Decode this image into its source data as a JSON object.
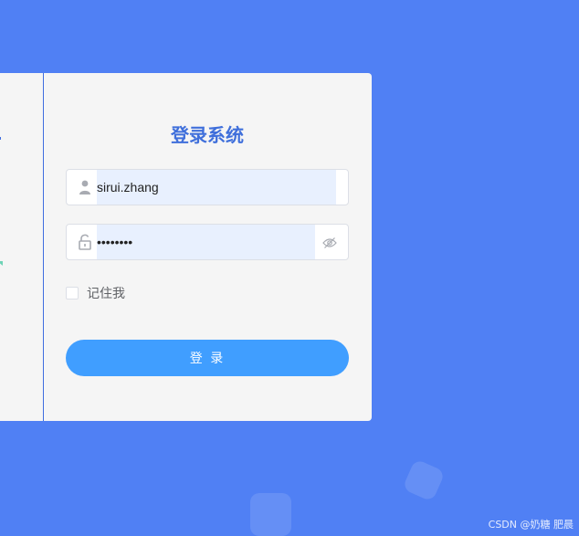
{
  "login": {
    "title": "登录系统",
    "username_value": "sirui.zhang",
    "password_value": "sirui.zh",
    "remember_label": "记住我",
    "login_button": "登 录"
  },
  "watermark": "CSDN @奶糖 肥晨",
  "icons": {
    "username": "user-icon",
    "password": "unlock-icon",
    "password_toggle": "eye-off-icon"
  },
  "colors": {
    "background": "#5080f4",
    "title": "#3f6fdb",
    "button": "#409eff"
  }
}
